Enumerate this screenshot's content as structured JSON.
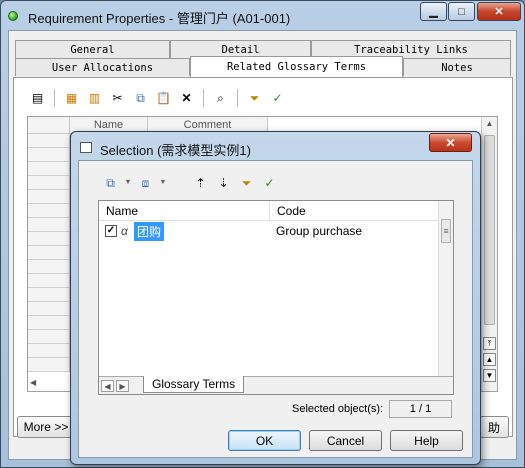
{
  "window": {
    "title": "Requirement Properties - 管理门户 (A01-001)",
    "min_label": "▁",
    "max_label": "□",
    "close_label": "✕"
  },
  "tabs_row1": [
    "General",
    "Detail",
    "Traceability Links"
  ],
  "tabs_row2": [
    "User Allocations",
    "Related Glossary Terms",
    "Notes"
  ],
  "active_tab": "Related Glossary Terms",
  "grid": {
    "columns": [
      "Name",
      "Comment"
    ]
  },
  "bottom": {
    "more_label": "More >>",
    "right_partial": "助"
  },
  "dialog": {
    "title": "Selection (需求模型实例1)",
    "close_label": "✕",
    "columns": [
      "Name",
      "Code"
    ],
    "rows": [
      {
        "checked": "✓",
        "icon": "α",
        "name": "团购",
        "code": "Group purchase"
      }
    ],
    "list_tab": "Glossary Terms",
    "selected_label": "Selected object(s):",
    "selected_value": "1 / 1",
    "ok_label": "OK",
    "cancel_label": "Cancel",
    "help_label": "Help"
  }
}
